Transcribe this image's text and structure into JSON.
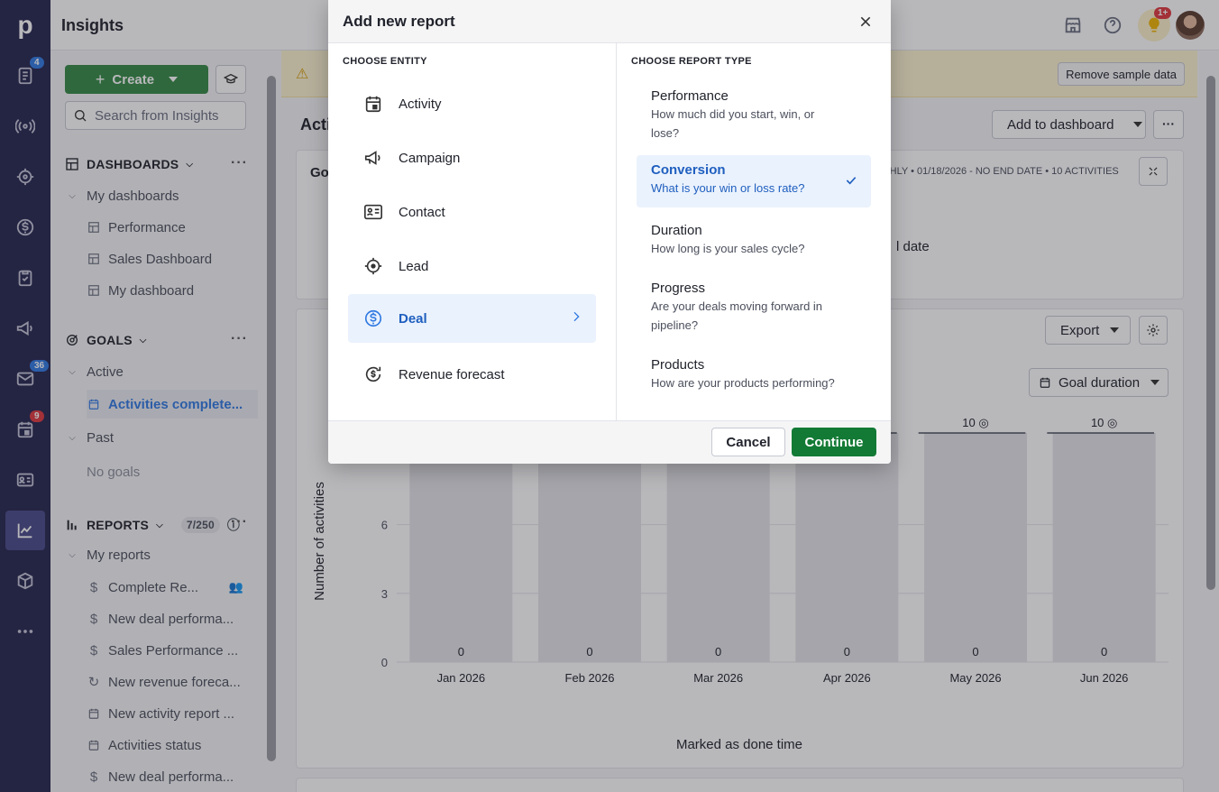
{
  "app": {
    "title": "Insights"
  },
  "rail": {
    "badges": {
      "leads": "4",
      "mail": "36",
      "activities": "9"
    }
  },
  "topbar": {
    "bulb_badge": "1+"
  },
  "sidebar": {
    "create_label": "Create",
    "search_placeholder": "Search from Insights",
    "dashboards": {
      "header": "DASHBOARDS",
      "group": "My dashboards",
      "items": [
        "Performance",
        "Sales Dashboard",
        "My dashboard"
      ]
    },
    "goals": {
      "header": "GOALS",
      "active_group": "Active",
      "active_items": [
        "Activities complete..."
      ],
      "past_group": "Past",
      "past_empty": "No goals"
    },
    "reports": {
      "header": "REPORTS",
      "count": "7/250",
      "group": "My reports",
      "items": [
        "Complete Re...",
        "New deal performa...",
        "Sales Performance ...",
        "New revenue foreca...",
        "New activity report ...",
        "Activities status",
        "New deal performa..."
      ]
    }
  },
  "main": {
    "remove_sample": "Remove sample data",
    "page_title": "Acti",
    "add_to_dashboard": "Add to dashboard",
    "goal_card": {
      "title": "Go",
      "meta": "NTHLY  •  01/18/2026 - NO END DATE  •  10 ACTIVITIES",
      "fragment": "l date"
    },
    "export_label": "Export",
    "goal_duration_label": "Goal duration"
  },
  "chart_data": {
    "type": "bar",
    "categories": [
      "Jan 2026",
      "Feb 2026",
      "Mar 2026",
      "Apr 2026",
      "May 2026",
      "Jun 2026"
    ],
    "values": [
      0,
      0,
      0,
      0,
      0,
      0
    ],
    "goal_values": [
      10,
      10,
      10,
      10,
      10,
      10
    ],
    "ylabel": "Number of activities",
    "xlabel": "Marked as done time",
    "yticks": [
      0,
      3,
      6
    ],
    "ylim": [
      0,
      10
    ],
    "grid": true
  },
  "modal": {
    "title": "Add new report",
    "entity_label": "CHOOSE ENTITY",
    "type_label": "CHOOSE REPORT TYPE",
    "entities": [
      {
        "label": "Activity",
        "icon": "calendar-icon"
      },
      {
        "label": "Campaign",
        "icon": "megaphone-icon"
      },
      {
        "label": "Contact",
        "icon": "contact-card-icon"
      },
      {
        "label": "Lead",
        "icon": "target-icon"
      },
      {
        "label": "Deal",
        "icon": "dollar-circle-icon",
        "selected": true
      },
      {
        "label": "Revenue forecast",
        "icon": "revenue-forecast-icon"
      }
    ],
    "report_types": [
      {
        "title": "Performance",
        "desc": "How much did you start, win, or lose?"
      },
      {
        "title": "Conversion",
        "desc": "What is your win or loss rate?",
        "selected": true
      },
      {
        "title": "Duration",
        "desc": "How long is your sales cycle?"
      },
      {
        "title": "Progress",
        "desc": "Are your deals moving forward in pipeline?"
      },
      {
        "title": "Products",
        "desc": "How are your products performing?"
      }
    ],
    "cancel_label": "Cancel",
    "continue_label": "Continue"
  },
  "colors": {
    "rail": "#26264f",
    "primary_green": "#137a35",
    "selection_blue": "#eaf2fd",
    "link_blue": "#1f5fbf"
  }
}
